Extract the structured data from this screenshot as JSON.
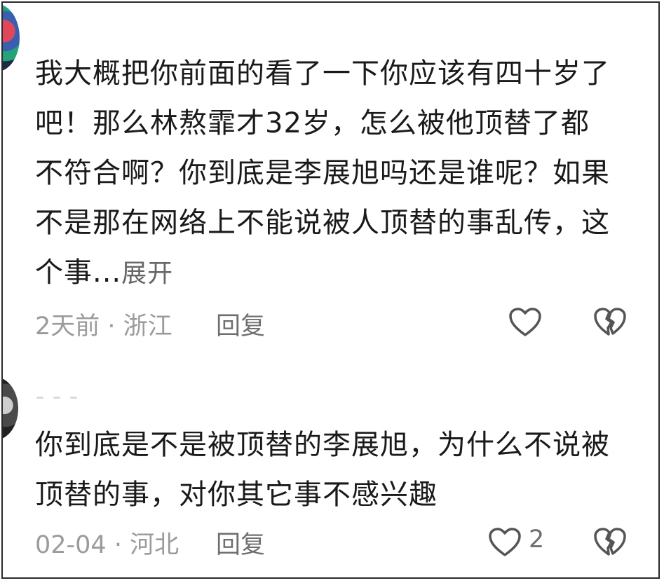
{
  "comments": [
    {
      "text": "我大概把你前面的看了一下你应该有四十岁了吧！那么林熬霏才32岁，怎么被他顶替了都不符合啊？你到底是李展旭吗还是谁呢？如果不是那在网络上不能说被人顶替的事乱传，这个事...",
      "expand_label": "展开",
      "datetime_location": "2天前 · 浙江",
      "reply_label": "回复",
      "like_count": ""
    },
    {
      "text": "你到底是不是被顶替的李展旭，为什么不说被顶替的事，对你其它事不感兴趣",
      "datetime_location": "02-04 · 河北",
      "reply_label": "回复",
      "like_count": "2"
    }
  ],
  "icons": {
    "like": "heart-outline-icon",
    "dislike": "broken-heart-icon"
  },
  "colors": {
    "text": "#1a1a1a",
    "meta": "#9b9b9b",
    "icon": "#555555"
  }
}
